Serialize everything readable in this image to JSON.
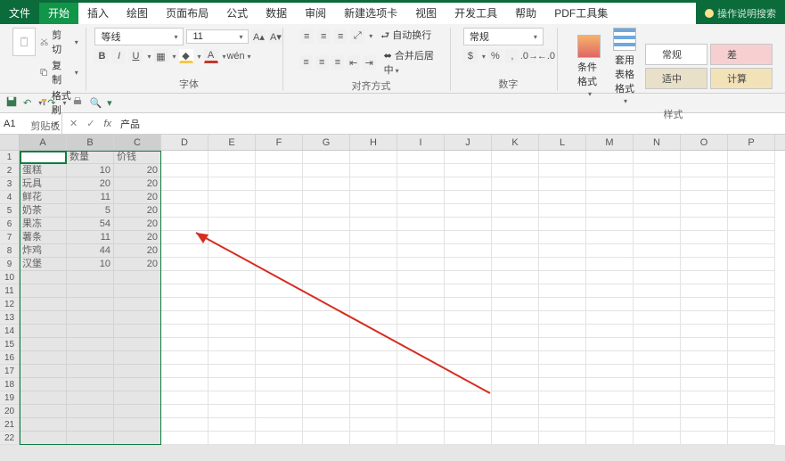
{
  "tabs": {
    "file": "文件",
    "home": "开始",
    "insert": "插入",
    "draw": "绘图",
    "layout": "页面布局",
    "formulas": "公式",
    "data": "数据",
    "review": "审阅",
    "newtab": "新建选项卡",
    "view": "视图",
    "dev": "开发工具",
    "help": "帮助",
    "pdf": "PDF工具集"
  },
  "search_hint": "操作说明搜索",
  "clipboard": {
    "paste": "粘贴",
    "cut": "剪切",
    "copy": "复制",
    "painter": "格式刷",
    "group": "剪贴板"
  },
  "font": {
    "name": "等线",
    "size": "11",
    "group": "字体"
  },
  "align": {
    "wrap": "自动换行",
    "merge": "合并后居中",
    "group": "对齐方式"
  },
  "number": {
    "format": "常规",
    "group": "数字"
  },
  "styles": {
    "cond": "条件格式",
    "table": "套用\n表格格式",
    "normal": "常规",
    "bad": "差",
    "neutral": "适中",
    "calc": "计算",
    "group": "样式"
  },
  "namebox": "A1",
  "fx_value": "产品",
  "columns": [
    "A",
    "B",
    "C",
    "D",
    "E",
    "F",
    "G",
    "H",
    "I",
    "J",
    "K",
    "L",
    "M",
    "N",
    "O",
    "P"
  ],
  "headers": {
    "a": "产品",
    "b": "数量",
    "c": "价钱"
  },
  "rows": [
    {
      "a": "蛋糕",
      "b": 10,
      "c": 20
    },
    {
      "a": "玩具",
      "b": 20,
      "c": 20
    },
    {
      "a": "鲜花",
      "b": 11,
      "c": 20
    },
    {
      "a": "奶茶",
      "b": 5,
      "c": 20
    },
    {
      "a": "果冻",
      "b": 54,
      "c": 20
    },
    {
      "a": "薯条",
      "b": 11,
      "c": 20
    },
    {
      "a": "炸鸡",
      "b": 44,
      "c": 20
    },
    {
      "a": "汉堡",
      "b": 10,
      "c": 20
    }
  ],
  "chart_data": {
    "type": "table",
    "title": "",
    "columns": [
      "产品",
      "数量",
      "价钱"
    ],
    "rows": [
      [
        "蛋糕",
        10,
        20
      ],
      [
        "玩具",
        20,
        20
      ],
      [
        "鲜花",
        11,
        20
      ],
      [
        "奶茶",
        5,
        20
      ],
      [
        "果冻",
        54,
        20
      ],
      [
        "薯条",
        11,
        20
      ],
      [
        "炸鸡",
        44,
        20
      ],
      [
        "汉堡",
        10,
        20
      ]
    ]
  }
}
